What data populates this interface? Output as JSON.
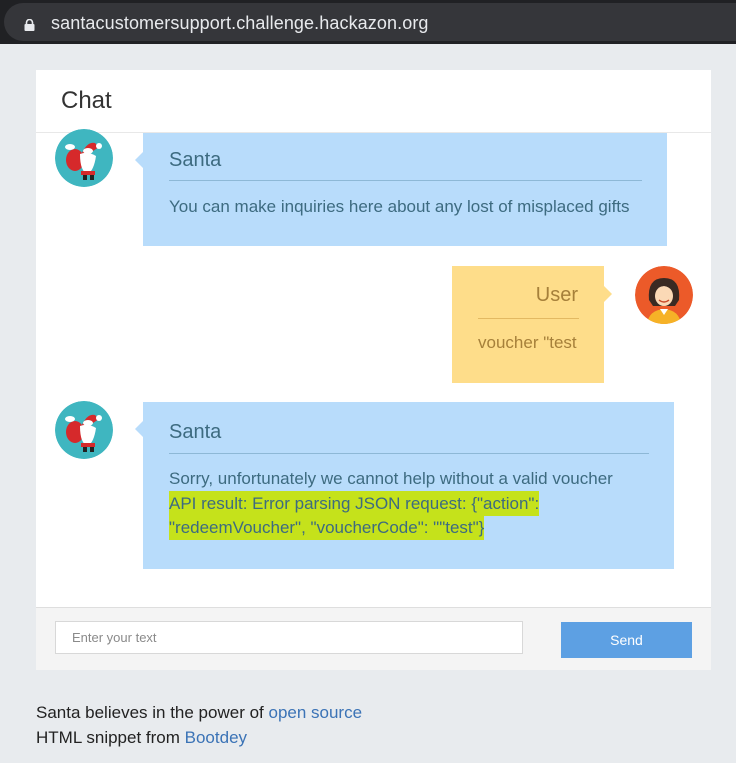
{
  "browser": {
    "url": "santacustomersupport.challenge.hackazon.org"
  },
  "chat": {
    "title": "Chat",
    "messages": [
      {
        "sender": "Santa",
        "lines": [
          "You can make inquiries here about any lost of misplaced gifts"
        ]
      },
      {
        "sender": "User",
        "lines": [
          "voucher \"test"
        ]
      },
      {
        "sender": "Santa",
        "lines": [
          "Sorry, unfortunately we cannot help without a valid voucher",
          "API result: Error parsing JSON request: {\"action\":",
          "\"redeemVoucher\", \"voucherCode\": \"\"test\"}"
        ]
      }
    ],
    "input_placeholder": "Enter your text",
    "send_label": "Send"
  },
  "credits": {
    "line1_prefix": "Santa believes in the power of ",
    "line1_link": "open source",
    "line2_prefix": "HTML snippet from ",
    "line2_link": "Bootdey"
  },
  "colors": {
    "santa_bubble": "#b8dcfb",
    "user_bubble": "#fedd8a",
    "send_button": "#5da0e3",
    "highlight": "#c5e21b",
    "link": "#3b73b6"
  },
  "icons": [
    "lock-icon",
    "santa-avatar",
    "user-avatar"
  ]
}
